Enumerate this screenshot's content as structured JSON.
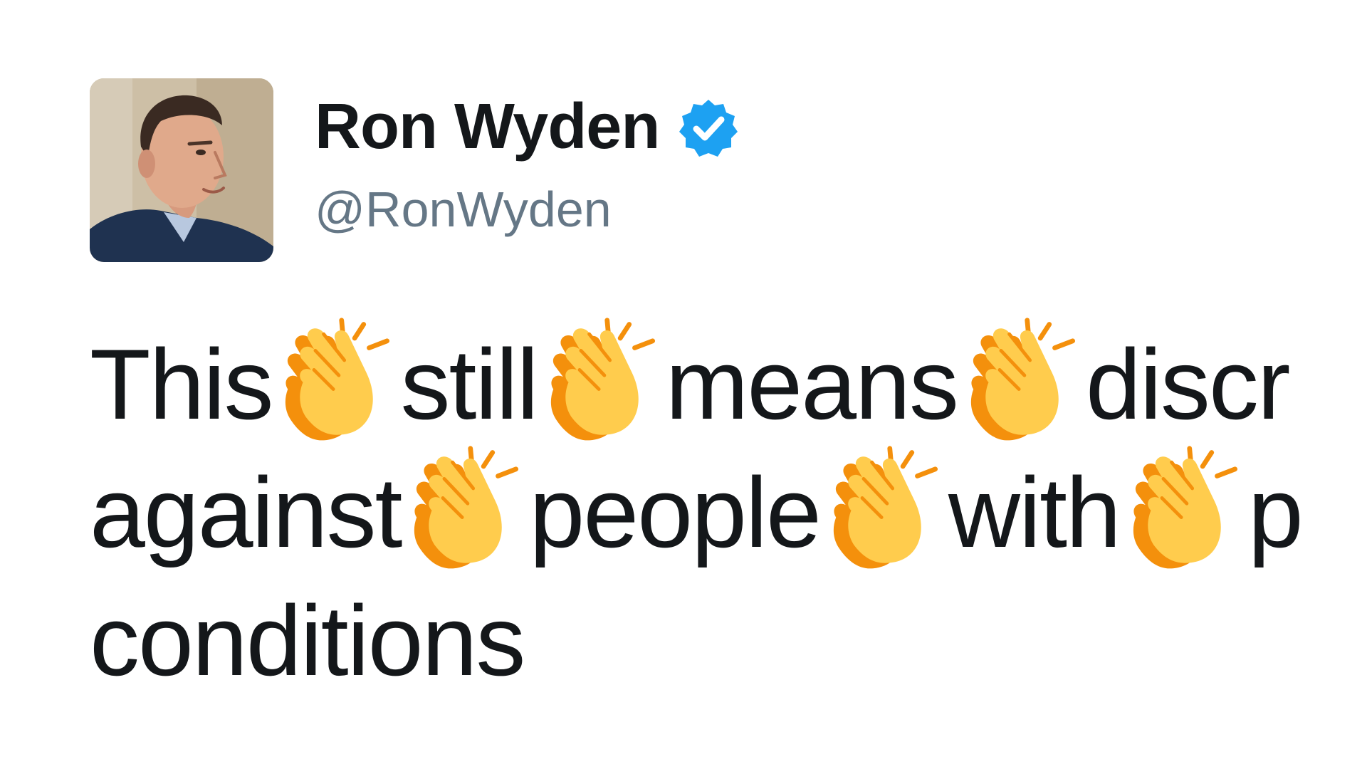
{
  "author": {
    "display_name": "Ron Wyden",
    "handle": "@RonWyden",
    "verified": true,
    "avatar_icon": "profile-photo",
    "verified_icon": "verified-badge-icon",
    "verified_color": "#1da1f2"
  },
  "tweet": {
    "line1": {
      "w1": "This",
      "w2": "still",
      "w3": "means",
      "w4": "discr"
    },
    "line2": {
      "w1": "against",
      "w2": "people",
      "w3": "with",
      "w4": "p"
    },
    "line3": {
      "w1": "conditions"
    },
    "separator_icon": "clapping-hands-emoji-icon"
  },
  "colors": {
    "text": "#14171a",
    "handle": "#657786",
    "background": "#ffffff",
    "clap_fill": "#ffcc4d",
    "clap_shadow": "#f4900c"
  }
}
